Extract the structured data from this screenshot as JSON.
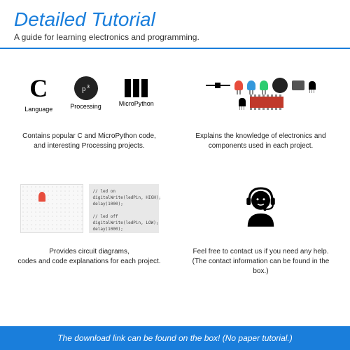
{
  "header": {
    "title": "Detailed Tutorial",
    "subtitle": "A guide for learning electronics and programming."
  },
  "languages": {
    "c": {
      "symbol": "C",
      "label": "Language"
    },
    "processing": {
      "symbol": "p³",
      "label": "Processing"
    },
    "micropython": {
      "label": "MicroPython"
    }
  },
  "captions": {
    "cell1_line1": "Contains popular C and MicroPython code,",
    "cell1_line2": "and interesting Processing projects.",
    "cell2_line1": "Explains the knowledge of electronics and",
    "cell2_line2": "components used in each project.",
    "cell3_line1": "Provides circuit diagrams,",
    "cell3_line2": "codes and code explanations for each project.",
    "cell4_line1": "Feel free to contact us if you need any help.",
    "cell4_line2": "(The contact information can be found in the box.)"
  },
  "code_sample": "// led on\ndigitalWrite(ledPin, HIGH);\ndelay(1000);\n\n// led off\ndigitalWrite(ledPin, LOW);\ndelay(1000);",
  "footer": {
    "text": "The download link can be found on the box! (No paper tutorial.)"
  }
}
